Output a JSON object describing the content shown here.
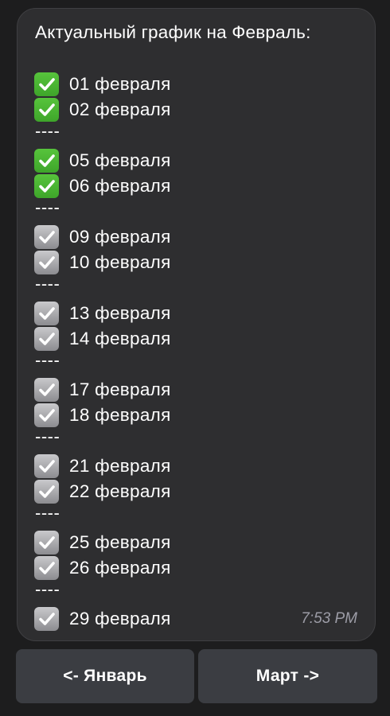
{
  "message": {
    "title": "Актуальный график на Февраль:",
    "time": "7:53 PM",
    "separator": "----",
    "groups": [
      [
        {
          "label": "01 февраля",
          "status": "done"
        },
        {
          "label": "02 февраля",
          "status": "done"
        }
      ],
      [
        {
          "label": "05 февраля",
          "status": "done"
        },
        {
          "label": "06 февраля",
          "status": "done"
        }
      ],
      [
        {
          "label": "09 февраля",
          "status": "muted"
        },
        {
          "label": "10 февраля",
          "status": "muted"
        }
      ],
      [
        {
          "label": "13 февраля",
          "status": "muted"
        },
        {
          "label": "14 февраля",
          "status": "muted"
        }
      ],
      [
        {
          "label": "17 февраля",
          "status": "muted"
        },
        {
          "label": "18 февраля",
          "status": "muted"
        }
      ],
      [
        {
          "label": "21 февраля",
          "status": "muted"
        },
        {
          "label": "22 февраля",
          "status": "muted"
        }
      ],
      [
        {
          "label": "25 февраля",
          "status": "muted"
        },
        {
          "label": "26 февраля",
          "status": "muted"
        }
      ],
      [
        {
          "label": "29 февраля",
          "status": "muted"
        }
      ]
    ],
    "icons": {
      "done": "green-check-mark-box-icon",
      "muted": "gray-check-mark-box-icon"
    }
  },
  "buttons": {
    "prev_label": "<- Январь",
    "next_label": "Март ->"
  },
  "colors": {
    "background": "#1d1d1e",
    "bubble": "#2e2e30",
    "button": "#3b3d42",
    "check_done": "#4cb535",
    "check_muted": "#a9a9ad",
    "time_text": "#9c9ca6"
  }
}
